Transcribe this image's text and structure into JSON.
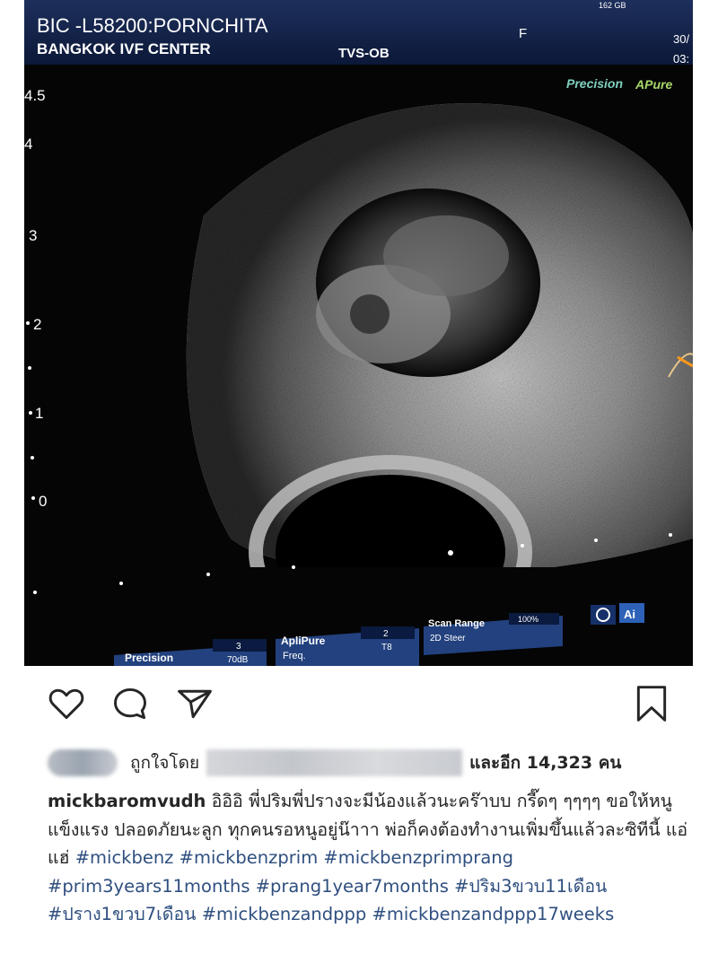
{
  "ultrasound": {
    "patient_id": "BIC -L58200:PORNCHITA",
    "clinic": "BANGKOK IVF CENTER",
    "mode": "TVS-OB",
    "sex_marker": "F",
    "date_fragment": "30/",
    "time_fragment": "03:",
    "storage_fragment": "162 GB",
    "brand_precision": "Precision",
    "brand_apure": "APure",
    "depth_ticks": [
      "4.5",
      "4",
      "3",
      "2",
      "1",
      "0"
    ],
    "controls": {
      "precision_label": "Precision",
      "precision_value": "3",
      "precision_db": "70dB",
      "aplipure_label": "ApliPure",
      "aplipure_value": "2",
      "freq_label": "Freq.",
      "freq_value": "T8",
      "scan_range_label": "Scan Range",
      "scan_range_value": "100%",
      "steer_label": "2D Steer"
    }
  },
  "actions": {
    "like_icon": "heart-icon",
    "comment_icon": "comment-icon",
    "share_icon": "send-icon",
    "save_icon": "bookmark-icon"
  },
  "likes": {
    "prefix": "ถูกใจโดย",
    "suffix_text": "และอีก",
    "count": "14,323",
    "unit": "คน"
  },
  "caption": {
    "username": "mickbaromvudh",
    "text": "อิอิอิ พี่ปริมพี่ปรางจะมีน้องแล้วนะคร๊าบบ กรี๊ดๆ ๆๆๆๆ ขอให้หนูแข็งแรง ปลอดภัยนะลูก ทุกคนรอหนูอยู่น๊าาา พ่อก็คงต้องทำงานเพิ่มขึ้นแล้วละซิทีนี้ แอ่แฮ่",
    "hashtags": [
      "#mickbenz",
      "#mickbenzprim",
      "#mickbenzprimprang",
      "#prim3years11months",
      "#prang1year7months",
      "#ปริม3ขวบ11เดือน",
      "#ปราง1ขวบ7เดือน",
      "#mickbenzandppp",
      "#mickbenzandppp17weeks"
    ]
  }
}
